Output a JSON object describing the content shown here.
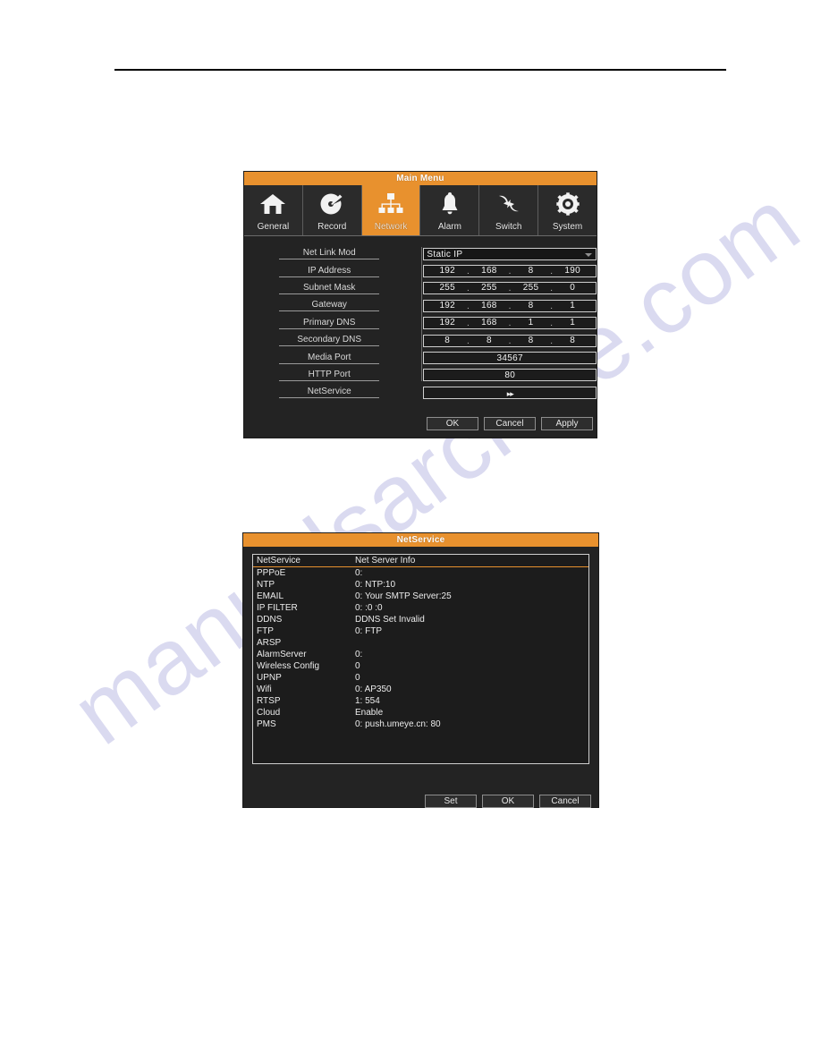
{
  "page": {
    "background_color": "#ffffff",
    "rule_color": "#000000",
    "watermark_text": "manualsarchive.com",
    "watermark_color": "#5b5bbf",
    "accent_color": "#e8912e",
    "panel_color": "#232323"
  },
  "main_menu": {
    "title": "Main Menu",
    "tabs": [
      {
        "label": "General",
        "icon": "home-icon",
        "active": false
      },
      {
        "label": "Record",
        "icon": "disc-icon",
        "active": false
      },
      {
        "label": "Network",
        "icon": "network-tree-icon",
        "active": true
      },
      {
        "label": "Alarm",
        "icon": "bell-icon",
        "active": false
      },
      {
        "label": "Switch",
        "icon": "switch-arrows-icon",
        "active": false
      },
      {
        "label": "System",
        "icon": "gear-icon",
        "active": false
      }
    ],
    "fields": {
      "net_link_mod": {
        "label": "Net Link Mod",
        "value": "Static IP",
        "type": "select"
      },
      "ip_address": {
        "label": "IP Address",
        "octets": [
          "192",
          "168",
          "8",
          "190"
        ],
        "type": "ip"
      },
      "subnet_mask": {
        "label": "Subnet Mask",
        "octets": [
          "255",
          "255",
          "255",
          "0"
        ],
        "type": "ip"
      },
      "gateway": {
        "label": "Gateway",
        "octets": [
          "192",
          "168",
          "8",
          "1"
        ],
        "type": "ip"
      },
      "primary_dns": {
        "label": "Primary DNS",
        "octets": [
          "192",
          "168",
          "1",
          "1"
        ],
        "type": "ip"
      },
      "secondary_dns": {
        "label": "Secondary DNS",
        "octets": [
          "8",
          "8",
          "8",
          "8"
        ],
        "type": "ip"
      },
      "media_port": {
        "label": "Media Port",
        "value": "34567",
        "type": "text"
      },
      "http_port": {
        "label": "HTTP Port",
        "value": "80",
        "type": "text"
      },
      "netservice": {
        "label": "NetService",
        "value": "▸▸",
        "type": "button"
      }
    },
    "buttons": {
      "ok": "OK",
      "cancel": "Cancel",
      "apply": "Apply"
    }
  },
  "netservice": {
    "title": "NetService",
    "columns": {
      "name": "NetService",
      "info": "Net Server Info"
    },
    "rows": [
      {
        "name": "PPPoE",
        "info": "0:"
      },
      {
        "name": "NTP",
        "info": "0: NTP:10"
      },
      {
        "name": "EMAIL",
        "info": "0: Your SMTP Server:25"
      },
      {
        "name": "IP FILTER",
        "info": "0: :0 :0"
      },
      {
        "name": "DDNS",
        "info": "DDNS Set Invalid"
      },
      {
        "name": "FTP",
        "info": "0: FTP"
      },
      {
        "name": "ARSP",
        "info": ""
      },
      {
        "name": "AlarmServer",
        "info": "0:"
      },
      {
        "name": "Wireless Config",
        "info": "0"
      },
      {
        "name": "UPNP",
        "info": "0"
      },
      {
        "name": "Wifi",
        "info": "0: AP350"
      },
      {
        "name": "RTSP",
        "info": "1: 554"
      },
      {
        "name": "Cloud",
        "info": "Enable"
      },
      {
        "name": "PMS",
        "info": "0: push.umeye.cn: 80"
      }
    ],
    "buttons": {
      "set": "Set",
      "ok": "OK",
      "cancel": "Cancel"
    }
  }
}
